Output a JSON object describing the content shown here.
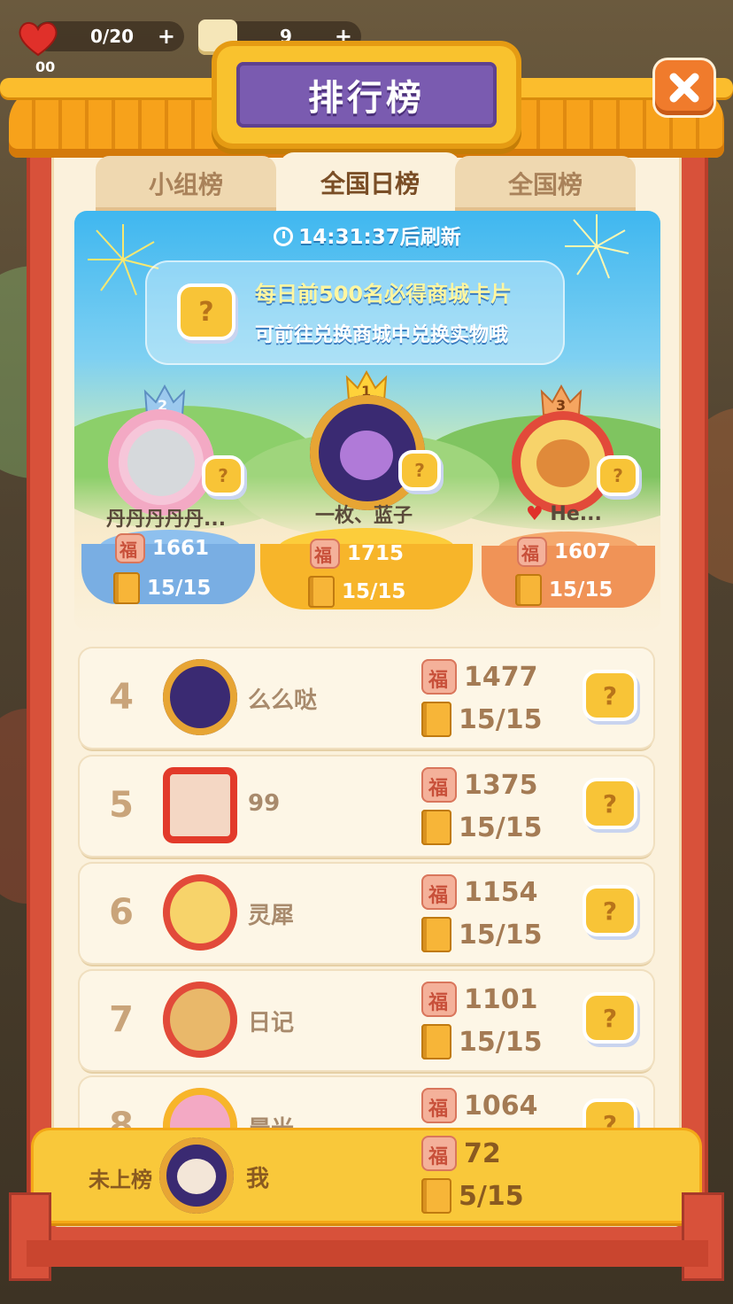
{
  "status": {
    "hearts": "0/20",
    "hearts_timer": "00",
    "dice_count": "9"
  },
  "header": {
    "title": "排行榜"
  },
  "tabs": [
    {
      "label": "小组榜",
      "active": false
    },
    {
      "label": "全国日榜",
      "active": true
    },
    {
      "label": "全国榜",
      "active": false
    }
  ],
  "banner": {
    "refresh": "14:31:37后刷新",
    "promo_line1": "每日前500名必得商城卡片",
    "promo_line2": "可前往兑换商城中兑换实物哦",
    "card_symbol": "?"
  },
  "podium": [
    {
      "rank": "1",
      "name": "一枚、蓝子",
      "score": "1715",
      "progress": "15/15"
    },
    {
      "rank": "2",
      "name": "丹丹丹丹丹...",
      "score": "1661",
      "progress": "15/15"
    },
    {
      "rank": "3",
      "name": "He...",
      "score": "1607",
      "progress": "15/15"
    }
  ],
  "rows": [
    {
      "rank": "4",
      "name": "么么哒",
      "score": "1477",
      "progress": "15/15"
    },
    {
      "rank": "5",
      "name": "99",
      "score": "1375",
      "progress": "15/15"
    },
    {
      "rank": "6",
      "name": "灵犀",
      "score": "1154",
      "progress": "15/15"
    },
    {
      "rank": "7",
      "name": "日记",
      "score": "1101",
      "progress": "15/15"
    },
    {
      "rank": "8",
      "name": "晨光",
      "score": "1064",
      "progress": ""
    }
  ],
  "me": {
    "label": "未上榜",
    "name": "我",
    "score": "72",
    "progress": "5/15"
  },
  "colors": {
    "frame_red": "#d8513a",
    "roof_gold": "#f7a21b",
    "title_purple": "#7a5bb0",
    "gold_podium": "#f9c22e",
    "silver_podium": "#7fb3e6",
    "bronze_podium": "#f0985a",
    "panel_cream": "#fbf1dc"
  },
  "icons": [
    "heart-icon",
    "dice-icon",
    "close-icon",
    "clock-icon",
    "fu-coin-icon",
    "book-icon",
    "card-icon",
    "crown-icon"
  ]
}
